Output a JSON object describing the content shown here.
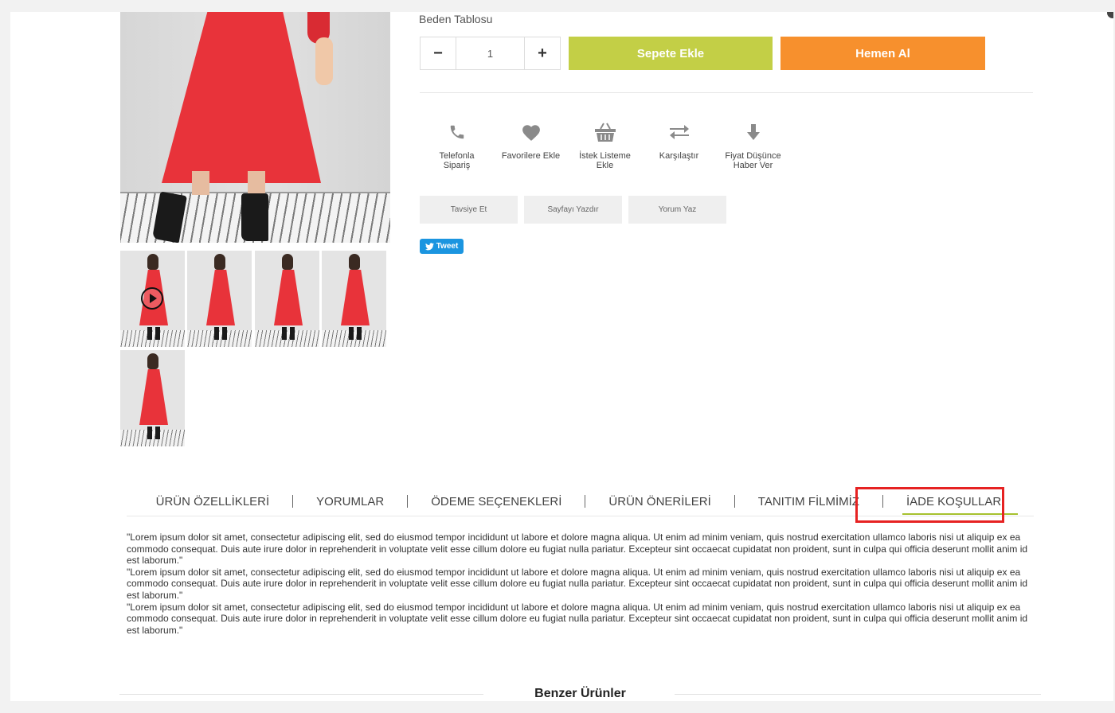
{
  "product": {
    "size_table_label": "Beden Tablosu",
    "quantity": "1",
    "minus_label": "−",
    "plus_label": "+",
    "add_to_cart_label": "Sepete Ekle",
    "buy_now_label": "Hemen Al",
    "colors": {
      "cart": "#c3cf46",
      "buy": "#f7902d",
      "dress": "#e8333a"
    }
  },
  "actions": [
    {
      "label": "Telefonla Sipariş",
      "icon": "phone-icon"
    },
    {
      "label": "Favorilere Ekle",
      "icon": "heart-icon"
    },
    {
      "label": "İstek Listeme Ekle",
      "icon": "basket-icon"
    },
    {
      "label": "Karşılaştır",
      "icon": "compare-icon"
    },
    {
      "label": "Fiyat Düşünce Haber Ver",
      "icon": "arrow-down-icon"
    }
  ],
  "small_buttons": [
    "Tavsiye Et",
    "Sayfayı Yazdır",
    "Yorum Yaz"
  ],
  "tweet_label": "Tweet",
  "tabs": [
    "ÜRÜN ÖZELLİKLERİ",
    "YORUMLAR",
    "ÖDEME SEÇENEKLERİ",
    "ÜRÜN ÖNERİLERİ",
    "TANITIM FİLMİMİZ",
    "İADE KOŞULLARI"
  ],
  "active_tab": "İADE KOŞULLARI",
  "description": [
    "\"Lorem ipsum dolor sit amet, consectetur adipiscing elit, sed do eiusmod tempor incididunt ut labore et dolore magna aliqua. Ut enim ad minim veniam, quis nostrud exercitation ullamco laboris nisi ut aliquip ex ea commodo consequat. Duis aute irure dolor in reprehenderit in voluptate velit esse cillum dolore eu fugiat nulla pariatur. Excepteur sint occaecat cupidatat non proident, sunt in culpa qui officia deserunt mollit anim id est laborum.\"",
    "\"Lorem ipsum dolor sit amet, consectetur adipiscing elit, sed do eiusmod tempor incididunt ut labore et dolore magna aliqua. Ut enim ad minim veniam, quis nostrud exercitation ullamco laboris nisi ut aliquip ex ea commodo consequat. Duis aute irure dolor in reprehenderit in voluptate velit esse cillum dolore eu fugiat nulla pariatur. Excepteur sint occaecat cupidatat non proident, sunt in culpa qui officia deserunt mollit anim id est laborum.\"",
    "\"Lorem ipsum dolor sit amet, consectetur adipiscing elit, sed do eiusmod tempor incididunt ut labore et dolore magna aliqua. Ut enim ad minim veniam, quis nostrud exercitation ullamco laboris nisi ut aliquip ex ea commodo consequat. Duis aute irure dolor in reprehenderit in voluptate velit esse cillum dolore eu fugiat nulla pariatur. Excepteur sint occaecat cupidatat non proident, sunt in culpa qui officia deserunt mollit anim id est laborum.\""
  ],
  "similar_products_title": "Benzer Ürünler"
}
